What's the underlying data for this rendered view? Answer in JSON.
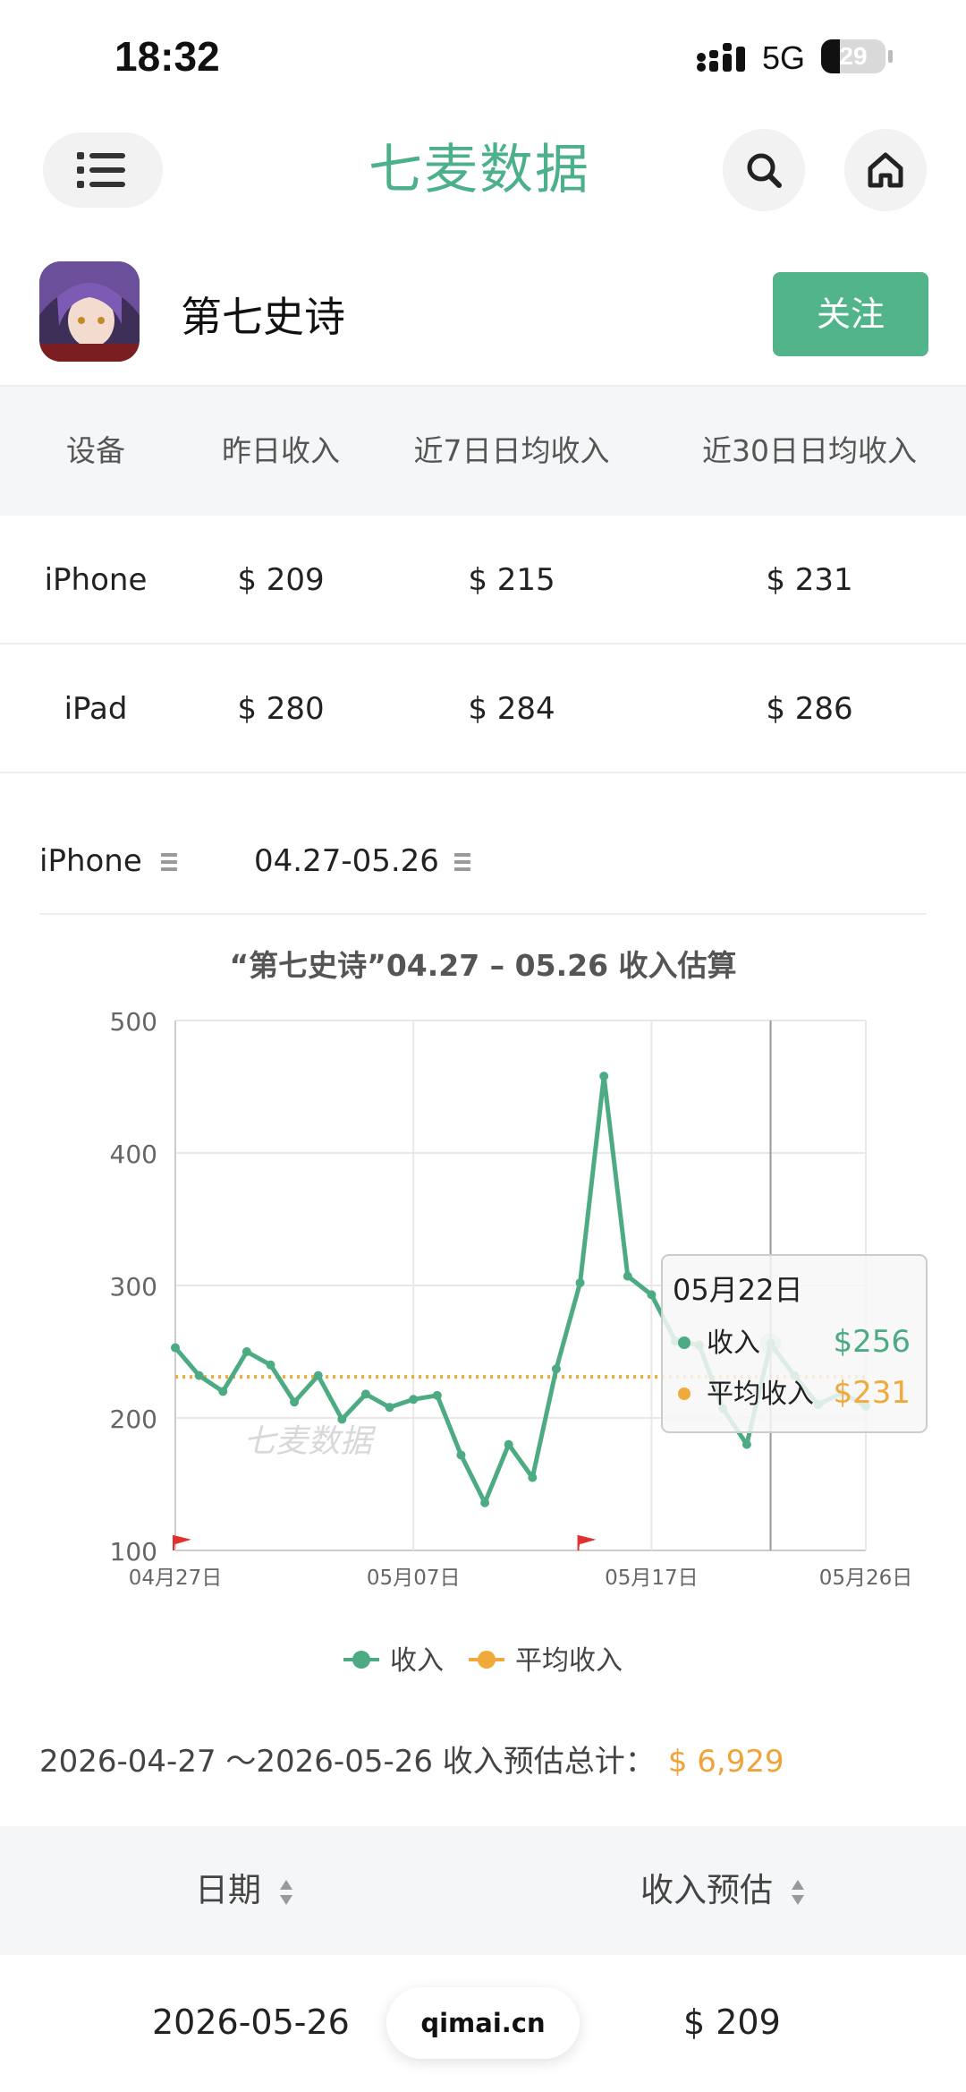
{
  "status_bar": {
    "time": "18:32",
    "network": "5G",
    "battery": "29",
    "battery_level": 0.29
  },
  "header": {
    "logo_text": "七麦数据",
    "menu_icon": "list-icon",
    "search_icon": "search-icon",
    "home_icon": "home-icon"
  },
  "app": {
    "name": "第七史诗",
    "follow_label": "关注"
  },
  "stats": {
    "headers": [
      "设备",
      "昨日收入",
      "近7日日均收入",
      "近30日日均收入"
    ],
    "rows": [
      [
        "iPhone",
        "$ 209",
        "$ 215",
        "$ 231"
      ],
      [
        "iPad",
        "$ 280",
        "$ 284",
        "$ 286"
      ]
    ]
  },
  "filters": {
    "device": "iPhone",
    "range": "04.27-05.26"
  },
  "chart_data": {
    "type": "line",
    "title": "“第七史诗”04.27 – 05.26 收入估算",
    "ylim": [
      100,
      500
    ],
    "yticks": [
      "500",
      "400",
      "300",
      "200",
      "100"
    ],
    "xticks": [
      "04月27日",
      "05月07日",
      "05月17日",
      "05月26日"
    ],
    "x": [
      "04-27",
      "04-28",
      "04-29",
      "04-30",
      "05-01",
      "05-02",
      "05-03",
      "05-04",
      "05-05",
      "05-06",
      "05-07",
      "05-08",
      "05-09",
      "05-10",
      "05-11",
      "05-12",
      "05-13",
      "05-14",
      "05-15",
      "05-16",
      "05-17",
      "05-18",
      "05-19",
      "05-20",
      "05-21",
      "05-22",
      "05-23",
      "05-24",
      "05-25",
      "05-26"
    ],
    "series": [
      {
        "name": "收入",
        "color": "#4cab83",
        "values": [
          253,
          232,
          220,
          250,
          240,
          212,
          232,
          199,
          218,
          208,
          214,
          217,
          172,
          136,
          180,
          155,
          237,
          302,
          458,
          307,
          293,
          258,
          255,
          207,
          180,
          256,
          232,
          210,
          219,
          209
        ]
      },
      {
        "name": "平均收入",
        "color": "#f0a93b",
        "values": [
          231,
          231,
          231,
          231,
          231,
          231,
          231,
          231,
          231,
          231,
          231,
          231,
          231,
          231,
          231,
          231,
          231,
          231,
          231,
          231,
          231,
          231,
          231,
          231,
          231,
          231,
          231,
          231,
          231,
          231
        ]
      }
    ],
    "watermark": "七麦数据",
    "tooltip": {
      "title": "05月22日",
      "rows": [
        {
          "label": "收入",
          "value": "$256",
          "color": "#4cab83"
        },
        {
          "label": "平均收入",
          "value": "$231",
          "color": "#f0a93b"
        }
      ],
      "index": 25
    },
    "legend": [
      {
        "label": "收入",
        "color": "#4cab83"
      },
      {
        "label": "平均收入",
        "color": "#f0a93b"
      }
    ],
    "legend_position": "bottom-center",
    "grid": true,
    "flag_markers_at": [
      "04-27",
      "05-14"
    ]
  },
  "total": {
    "label": "2026-04-27 ～2026-05-26 收入预估总计：",
    "value": "$ 6,929"
  },
  "table": {
    "headers": [
      "日期",
      "收入预估"
    ],
    "rows": [
      [
        "2026-05-26",
        "$ 209"
      ]
    ]
  },
  "footer_pill": "qimai.cn",
  "colors": {
    "accent": "#52b48a",
    "orange": "#f0a33a"
  }
}
